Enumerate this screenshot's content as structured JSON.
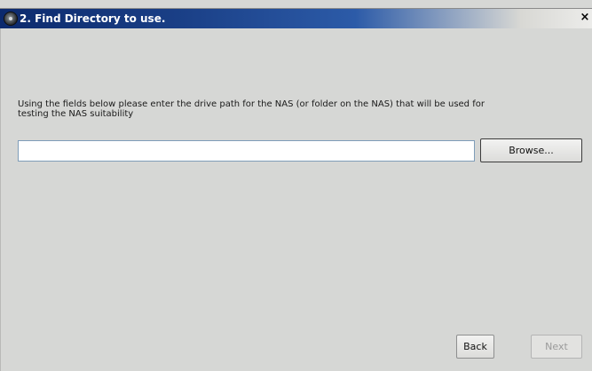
{
  "window": {
    "title": "2. Find Directory to use.",
    "close_glyph": "×"
  },
  "main": {
    "instructions": "Using the fields below please enter the drive path for the NAS (or folder on the NAS) that will be used for\ntesting the NAS suitability",
    "path_input": {
      "value": "",
      "placeholder": ""
    },
    "browse_label": "Browse..."
  },
  "footer": {
    "back_label": "Back",
    "next_label": "Next"
  }
}
